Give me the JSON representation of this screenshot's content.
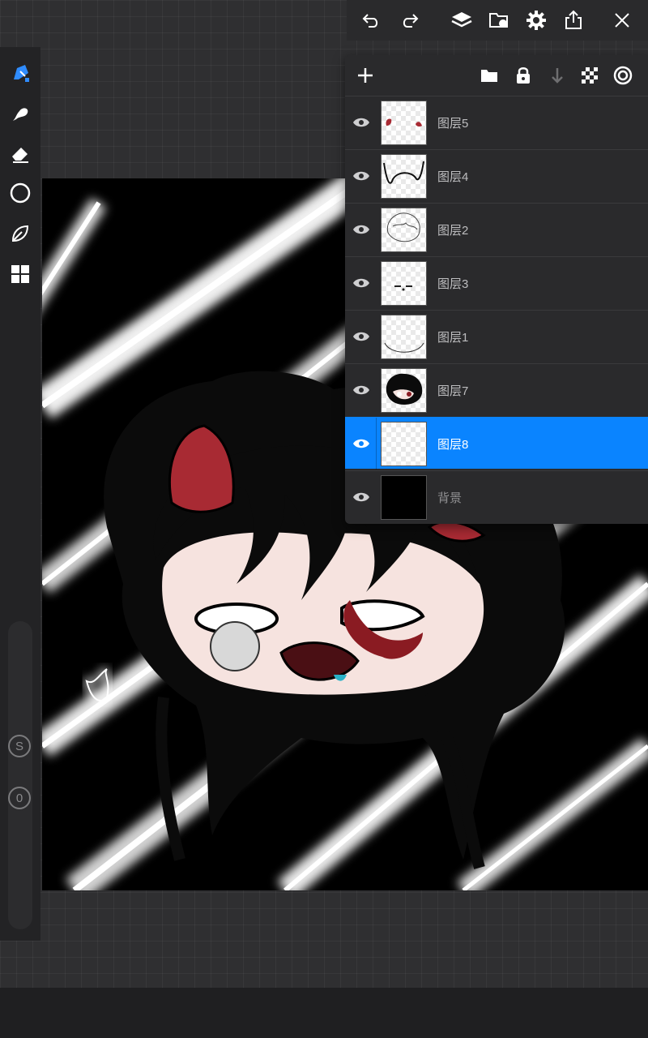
{
  "toolbar": {
    "undo_icon": "undo-icon",
    "redo_icon": "redo-icon",
    "layers_icon": "layers-icon",
    "import_icon": "import-icon",
    "settings_icon": "gear-icon",
    "export_icon": "share-icon",
    "close_icon": "close-icon"
  },
  "left_tools": [
    "brush-icon",
    "smudge-icon",
    "eraser-icon",
    "shape-icon",
    "fill-icon",
    "grid-icon"
  ],
  "slider": {
    "size_label": "S",
    "opacity_label": "0"
  },
  "layers_panel": {
    "header_icons": [
      "add-icon",
      "folder-icon",
      "lock-icon",
      "merge-down-icon",
      "checker-icon",
      "blend-icon"
    ],
    "layers": [
      {
        "name": "图层5",
        "visible": true,
        "selected": false
      },
      {
        "name": "图层4",
        "visible": true,
        "selected": false
      },
      {
        "name": "图层2",
        "visible": true,
        "selected": false
      },
      {
        "name": "图层3",
        "visible": true,
        "selected": false
      },
      {
        "name": "图层1",
        "visible": true,
        "selected": false
      },
      {
        "name": "图层7",
        "visible": true,
        "selected": false
      },
      {
        "name": "图层8",
        "visible": true,
        "selected": true
      },
      {
        "name": "背景",
        "visible": true,
        "selected": false
      }
    ]
  },
  "colors": {
    "accent": "#0a84ff",
    "panel": "#2a2a2c",
    "workspace": "#2f2f31"
  }
}
